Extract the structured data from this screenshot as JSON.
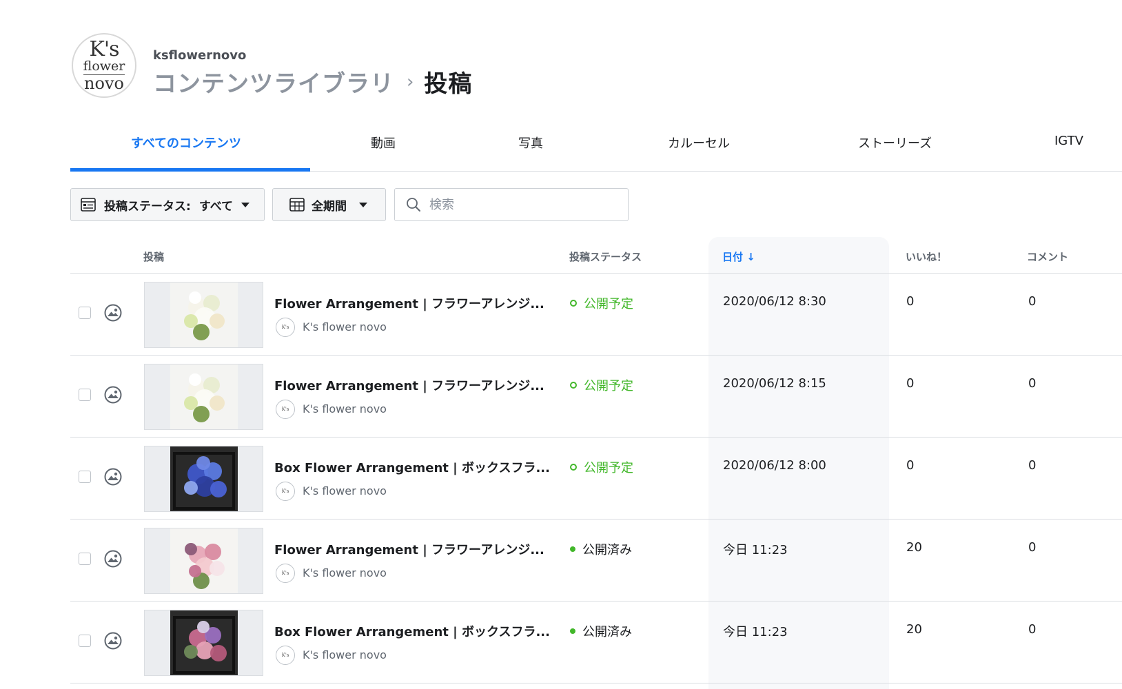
{
  "header": {
    "logo": {
      "line1": "K's",
      "line2": "flower",
      "line3": "novo"
    },
    "account": "ksflowernovo",
    "breadcrumb_parent": "コンテンツライブラリ",
    "breadcrumb_sep": "›",
    "breadcrumb_current": "投稿"
  },
  "tabs": [
    {
      "label": "すべてのコンテンツ",
      "active": true
    },
    {
      "label": "動画"
    },
    {
      "label": "写真"
    },
    {
      "label": "カルーセル"
    },
    {
      "label": "ストーリーズ"
    },
    {
      "label": "IGTV"
    }
  ],
  "filters": {
    "status_label": "投稿ステータス:",
    "status_value": "すべて",
    "period_label": "全期間",
    "search_placeholder": "検索"
  },
  "table": {
    "headers": {
      "post": "投稿",
      "status": "投稿ステータス",
      "date": "日付 ↓",
      "likes": "いいね！",
      "comments": "コメント"
    },
    "rows": [
      {
        "title": "Flower Arrangement | フラワーアレンジ...",
        "author": "K's flower novo",
        "status": "公開予定",
        "status_type": "scheduled",
        "date": "2020/06/12 8:30",
        "likes": "0",
        "comments": "0",
        "thumb": "bouquet-white"
      },
      {
        "title": "Flower Arrangement | フラワーアレンジ...",
        "author": "K's flower novo",
        "status": "公開予定",
        "status_type": "scheduled",
        "date": "2020/06/12 8:15",
        "likes": "0",
        "comments": "0",
        "thumb": "bouquet-white"
      },
      {
        "title": "Box Flower Arrangement | ボックスフラ...",
        "author": "K's flower novo",
        "status": "公開予定",
        "status_type": "scheduled",
        "date": "2020/06/12 8:00",
        "likes": "0",
        "comments": "0",
        "thumb": "box-blue"
      },
      {
        "title": "Flower Arrangement | フラワーアレンジ...",
        "author": "K's flower novo",
        "status": "公開済み",
        "status_type": "published",
        "date": "今日 11:23",
        "likes": "20",
        "comments": "0",
        "thumb": "bouquet-pink"
      },
      {
        "title": "Box Flower Arrangement | ボックスフラ...",
        "author": "K's flower novo",
        "status": "公開済み",
        "status_type": "published",
        "date": "今日 11:23",
        "likes": "20",
        "comments": "0",
        "thumb": "box-pink"
      }
    ]
  },
  "colors": {
    "accent": "#1877f2",
    "status_green": "#42b72a"
  }
}
